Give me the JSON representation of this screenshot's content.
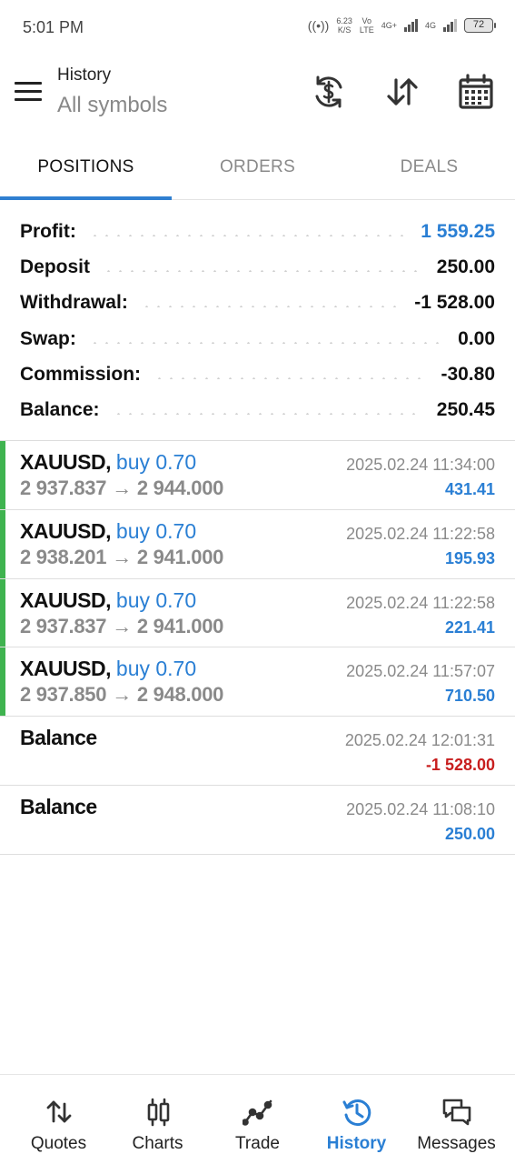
{
  "status_bar": {
    "time": "5:01 PM",
    "hotspot": "((•))",
    "speed_value": "6.23",
    "speed_unit": "K/S",
    "volte_top": "Vo",
    "volte_bottom": "LTE",
    "net1": "4G+",
    "net2": "4G",
    "battery": "72"
  },
  "header": {
    "title": "History",
    "subtitle": "All symbols",
    "icons": [
      "currency-sync-icon",
      "sort-icon",
      "calendar-icon"
    ]
  },
  "tabs": [
    {
      "label": "POSITIONS",
      "active": true
    },
    {
      "label": "ORDERS",
      "active": false
    },
    {
      "label": "DEALS",
      "active": false
    }
  ],
  "summary": [
    {
      "label": "Profit:",
      "value": "1 559.25",
      "color": "#2a7fd4"
    },
    {
      "label": "Deposit",
      "value": "250.00"
    },
    {
      "label": "Withdrawal:",
      "value": "-1 528.00"
    },
    {
      "label": "Swap:",
      "value": "0.00"
    },
    {
      "label": "Commission:",
      "value": "-30.80"
    },
    {
      "label": "Balance:",
      "value": "250.45"
    }
  ],
  "deals": [
    {
      "symbol": "XAUUSD,",
      "side": "buy 0.70",
      "open": "2 937.837",
      "arrow": "→",
      "close": "2 944.000",
      "time": "2025.02.24 11:34:00",
      "pnl": "431.41",
      "accent": "#3fb34f"
    },
    {
      "symbol": "XAUUSD,",
      "side": "buy 0.70",
      "open": "2 938.201",
      "arrow": "→",
      "close": "2 941.000",
      "time": "2025.02.24 11:22:58",
      "pnl": "195.93",
      "accent": "#3fb34f"
    },
    {
      "symbol": "XAUUSD,",
      "side": "buy 0.70",
      "open": "2 937.837",
      "arrow": "→",
      "close": "2 941.000",
      "time": "2025.02.24 11:22:58",
      "pnl": "221.41",
      "accent": "#3fb34f"
    },
    {
      "symbol": "XAUUSD,",
      "side": "buy 0.70",
      "open": "2 937.850",
      "arrow": "→",
      "close": "2 948.000",
      "time": "2025.02.24 11:57:07",
      "pnl": "710.50",
      "accent": "#3fb34f"
    }
  ],
  "balances": [
    {
      "label": "Balance",
      "time": "2025.02.24 12:01:31",
      "amount": "-1 528.00",
      "color": "#c81e1e"
    },
    {
      "label": "Balance",
      "time": "2025.02.24 11:08:10",
      "amount": "250.00",
      "color": "#2a7fd4"
    }
  ],
  "nav": [
    {
      "label": "Quotes",
      "icon": "quotes-icon",
      "active": false
    },
    {
      "label": "Charts",
      "icon": "charts-icon",
      "active": false
    },
    {
      "label": "Trade",
      "icon": "trade-icon",
      "active": false
    },
    {
      "label": "History",
      "icon": "history-icon",
      "active": true
    },
    {
      "label": "Messages",
      "icon": "messages-icon",
      "active": false
    }
  ],
  "colors": {
    "accent": "#2a7fd4",
    "profit_bar": "#3fb34f",
    "loss": "#c81e1e"
  }
}
